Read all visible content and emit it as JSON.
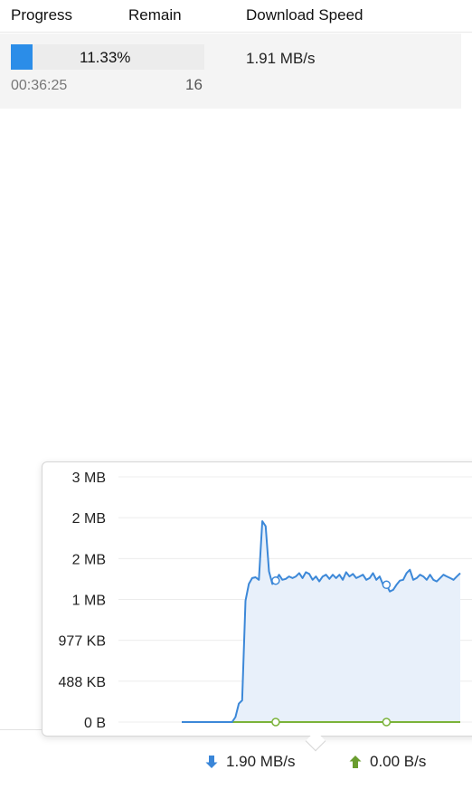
{
  "columns": {
    "progress": "Progress",
    "remain": "Remain",
    "download_speed": "Download Speed"
  },
  "task": {
    "progress_percent": 11.33,
    "progress_text": "11.33%",
    "elapsed": "00:36:25",
    "remain": "16",
    "download_speed": "1.91 MB/s"
  },
  "chart_data": {
    "type": "area",
    "y_tick_labels": [
      "3 MB",
      "2 MB",
      "2 MB",
      "1 MB",
      "977 KB",
      "488 KB",
      "0 B"
    ],
    "y_tick_values_kb": [
      2930,
      2442,
      1953,
      1465,
      977,
      488,
      0
    ],
    "ylim": [
      0,
      2930
    ],
    "grid": true,
    "series": [
      {
        "key": "download",
        "color": "#3c88d8",
        "values": [
          0,
          0,
          0,
          0,
          0,
          0,
          0,
          0,
          0,
          0,
          0,
          0,
          0,
          0,
          0,
          0,
          60,
          220,
          260,
          1450,
          1650,
          1720,
          1730,
          1700,
          2400,
          2340,
          1800,
          1650,
          1690,
          1760,
          1700,
          1710,
          1740,
          1720,
          1740,
          1780,
          1720,
          1790,
          1770,
          1700,
          1740,
          1680,
          1740,
          1760,
          1710,
          1760,
          1720,
          1760,
          1700,
          1790,
          1740,
          1770,
          1720,
          1740,
          1760,
          1700,
          1720,
          1780,
          1700,
          1740,
          1640,
          1640,
          1560,
          1580,
          1640,
          1690,
          1700,
          1780,
          1820,
          1700,
          1720,
          1760,
          1740,
          1700,
          1760,
          1700,
          1680,
          1720,
          1760,
          1740,
          1720,
          1700,
          1740,
          1780
        ]
      },
      {
        "key": "upload",
        "color": "#7bb33a",
        "values": [
          0,
          0,
          0,
          0,
          0,
          0,
          0,
          0,
          0,
          0,
          0,
          0,
          0,
          0,
          0,
          0,
          0,
          0,
          0,
          0,
          0,
          0,
          0,
          0,
          0,
          0,
          0,
          0,
          0,
          0,
          0,
          0,
          0,
          0,
          0,
          0,
          0,
          0,
          0,
          0,
          0,
          0,
          0,
          0,
          0,
          0,
          0,
          0,
          0,
          0,
          0,
          0,
          0,
          0,
          0,
          0,
          0,
          0,
          0,
          0,
          0,
          0,
          0,
          0,
          0,
          0,
          0,
          0,
          0,
          0,
          0,
          0,
          0,
          0,
          0,
          0,
          0,
          0,
          0,
          0,
          0,
          0,
          0,
          0
        ]
      }
    ]
  },
  "status_bar": {
    "download_speed": "1.90 MB/s",
    "upload_speed": "0.00 B/s",
    "download_color": "#3a86d8",
    "upload_color": "#6a9d2f"
  },
  "icons": {
    "download": "arrow-down-icon",
    "upload": "arrow-up-icon"
  }
}
